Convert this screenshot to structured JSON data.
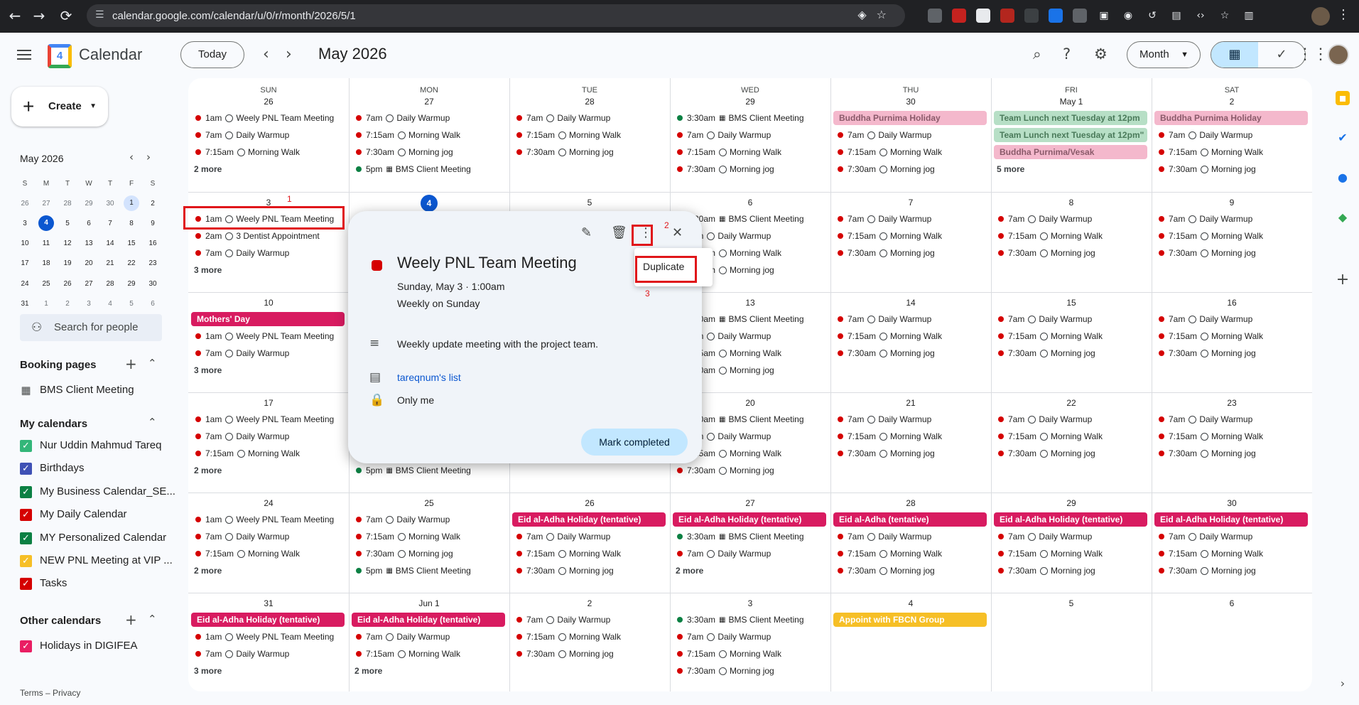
{
  "browser": {
    "url": "calendar.google.com/calendar/u/0/r/month/2026/5/1",
    "back_icon": "←",
    "forward_icon": "→",
    "reload_icon": "⟳"
  },
  "header": {
    "app_name": "Calendar",
    "logo_day": "4",
    "today_label": "Today",
    "month_title": "May 2026",
    "view_label": "Month"
  },
  "sidebar": {
    "create_label": "Create",
    "mini_title": "May 2026",
    "weekday_initials": [
      "S",
      "M",
      "T",
      "W",
      "T",
      "F",
      "S"
    ],
    "mini_weeks": [
      [
        "26",
        "27",
        "28",
        "29",
        "30",
        "1",
        "2"
      ],
      [
        "3",
        "4",
        "5",
        "6",
        "7",
        "8",
        "9"
      ],
      [
        "10",
        "11",
        "12",
        "13",
        "14",
        "15",
        "16"
      ],
      [
        "17",
        "18",
        "19",
        "20",
        "21",
        "22",
        "23"
      ],
      [
        "24",
        "25",
        "26",
        "27",
        "28",
        "29",
        "30"
      ],
      [
        "31",
        "1",
        "2",
        "3",
        "4",
        "5",
        "6"
      ]
    ],
    "search_people": "Search for people",
    "booking_title": "Booking pages",
    "booking_item": "BMS Client Meeting",
    "my_calendars_title": "My calendars",
    "my_calendars": [
      {
        "name": "Nur Uddin Mahmud Tareq",
        "color": "#33b679"
      },
      {
        "name": "Birthdays",
        "color": "#3f51b5"
      },
      {
        "name": "My Business Calendar_SE...",
        "color": "#0b8043"
      },
      {
        "name": "My Daily Calendar",
        "color": "#d50000"
      },
      {
        "name": "MY Personalized Calendar",
        "color": "#0b8043"
      },
      {
        "name": "NEW PNL Meeting at VIP ...",
        "color": "#f6bf26"
      },
      {
        "name": "Tasks",
        "color": "#d50000"
      }
    ],
    "other_calendars_title": "Other calendars",
    "other_calendars": [
      {
        "name": "Holidays in DIGIFEA",
        "color": "#e91e63"
      }
    ],
    "terms": "Terms – Privacy"
  },
  "grid": {
    "weekdays": [
      "SUN",
      "MON",
      "TUE",
      "WED",
      "THU",
      "FRI",
      "SAT"
    ],
    "day_numbers": [
      [
        "26",
        "27",
        "28",
        "29",
        "30",
        "May 1",
        "2"
      ],
      [
        "3",
        "4",
        "5",
        "6",
        "7",
        "8",
        "9"
      ],
      [
        "10",
        "11",
        "12",
        "13",
        "14",
        "15",
        "16"
      ],
      [
        "17",
        "18",
        "19",
        "20",
        "21",
        "22",
        "23"
      ],
      [
        "24",
        "25",
        "26",
        "27",
        "28",
        "29",
        "30"
      ],
      [
        "31",
        "Jun 1",
        "2",
        "3",
        "4",
        "5",
        "6"
      ]
    ],
    "weeks": [
      [
        {
          "events": [
            [
              "d",
              "1am",
              "Weely PNL Team Meeting"
            ],
            [
              "t",
              "7am",
              "Daily Warmup"
            ],
            [
              "t",
              "7:15am",
              "Morning Walk"
            ]
          ],
          "more": "2 more"
        },
        {
          "events": [
            [
              "t",
              "7am",
              "Daily Warmup"
            ],
            [
              "t",
              "7:15am",
              "Morning Walk"
            ],
            [
              "t",
              "7:30am",
              "Morning jog"
            ],
            [
              "g",
              "5pm",
              "BMS Client Meeting"
            ]
          ]
        },
        {
          "events": [
            [
              "t",
              "7am",
              "Daily Warmup"
            ],
            [
              "t",
              "7:15am",
              "Morning Walk"
            ],
            [
              "t",
              "7:30am",
              "Morning jog"
            ]
          ]
        },
        {
          "events": [
            [
              "g",
              "3:30am",
              "BMS Client Meeting"
            ],
            [
              "t",
              "7am",
              "Daily Warmup"
            ],
            [
              "t",
              "7:15am",
              "Morning Walk"
            ],
            [
              "t",
              "7:30am",
              "Morning jog"
            ]
          ]
        },
        {
          "allday": [
            [
              "Buddha Purnima Holiday",
              "#f4b8cc",
              "#8a5a6a"
            ]
          ],
          "events": [
            [
              "t",
              "7am",
              "Daily Warmup"
            ],
            [
              "t",
              "7:15am",
              "Morning Walk"
            ],
            [
              "t",
              "7:30am",
              "Morning jog"
            ]
          ]
        },
        {
          "allday": [
            [
              "Team Lunch next Tuesday at 12pm",
              "#b7dfc6",
              "#4a7a5a"
            ],
            [
              "Team Lunch next Tuesday at 12pm\"",
              "#b7dfc6",
              "#4a7a5a"
            ],
            [
              "Buddha Purnima/Vesak",
              "#f4b8cc",
              "#8a5a6a"
            ]
          ],
          "more": "5 more"
        },
        {
          "allday": [
            [
              "Buddha Purnima Holiday",
              "#f4b8cc",
              "#8a5a6a"
            ]
          ],
          "events": [
            [
              "t",
              "7am",
              "Daily Warmup"
            ],
            [
              "t",
              "7:15am",
              "Morning Walk"
            ],
            [
              "t",
              "7:30am",
              "Morning jog"
            ]
          ]
        }
      ],
      [
        {
          "events": [
            [
              "d",
              "1am",
              "Weely PNL Team Meeting"
            ],
            [
              "d",
              "2am",
              "3 Dentist Appointment"
            ],
            [
              "t",
              "7am",
              "Daily Warmup"
            ]
          ],
          "more": "3 more"
        },
        {
          "events": []
        },
        {
          "events": []
        },
        {
          "events": [
            [
              "g",
              "3:30am",
              "BMS Client Meeting"
            ],
            [
              "t",
              "7am",
              "Daily Warmup"
            ],
            [
              "t",
              "7:15am",
              "Morning Walk"
            ],
            [
              "t",
              "7:30am",
              "Morning jog"
            ]
          ]
        },
        {
          "events": [
            [
              "t",
              "7am",
              "Daily Warmup"
            ],
            [
              "t",
              "7:15am",
              "Morning Walk"
            ],
            [
              "t",
              "7:30am",
              "Morning jog"
            ]
          ]
        },
        {
          "events": [
            [
              "t",
              "7am",
              "Daily Warmup"
            ],
            [
              "t",
              "7:15am",
              "Morning Walk"
            ],
            [
              "t",
              "7:30am",
              "Morning jog"
            ]
          ]
        },
        {
          "events": [
            [
              "t",
              "7am",
              "Daily Warmup"
            ],
            [
              "t",
              "7:15am",
              "Morning Walk"
            ],
            [
              "t",
              "7:30am",
              "Morning jog"
            ]
          ]
        }
      ],
      [
        {
          "allday": [
            [
              "Mothers' Day",
              "#d81b60",
              "#ffffff"
            ]
          ],
          "events": [
            [
              "d",
              "1am",
              "Weely PNL Team Meeting"
            ],
            [
              "t",
              "7am",
              "Daily Warmup"
            ]
          ],
          "more": "3 more"
        },
        {
          "events": []
        },
        {
          "events": []
        },
        {
          "events": [
            [
              "g",
              "3:30am",
              "BMS Client Meeting"
            ],
            [
              "t",
              "7am",
              "Daily Warmup"
            ],
            [
              "t",
              "7:15am",
              "Morning Walk"
            ],
            [
              "t",
              "7:30am",
              "Morning jog"
            ]
          ]
        },
        {
          "events": [
            [
              "t",
              "7am",
              "Daily Warmup"
            ],
            [
              "t",
              "7:15am",
              "Morning Walk"
            ],
            [
              "t",
              "7:30am",
              "Morning jog"
            ]
          ]
        },
        {
          "events": [
            [
              "t",
              "7am",
              "Daily Warmup"
            ],
            [
              "t",
              "7:15am",
              "Morning Walk"
            ],
            [
              "t",
              "7:30am",
              "Morning jog"
            ]
          ]
        },
        {
          "events": [
            [
              "t",
              "7am",
              "Daily Warmup"
            ],
            [
              "t",
              "7:15am",
              "Morning Walk"
            ],
            [
              "t",
              "7:30am",
              "Morning jog"
            ]
          ]
        }
      ],
      [
        {
          "events": [
            [
              "d",
              "1am",
              "Weely PNL Team Meeting"
            ],
            [
              "t",
              "7am",
              "Daily Warmup"
            ],
            [
              "t",
              "7:15am",
              "Morning Walk"
            ]
          ],
          "more": "2 more"
        },
        {
          "events": [
            [
              "",
              "",
              ""
            ],
            [
              "",
              "",
              ""
            ],
            [
              "",
              "",
              ""
            ],
            [
              "g",
              "5pm",
              "BMS Client Meeting"
            ]
          ]
        },
        {
          "events": []
        },
        {
          "events": [
            [
              "g",
              "3:30am",
              "BMS Client Meeting"
            ],
            [
              "t",
              "7am",
              "Daily Warmup"
            ],
            [
              "t",
              "7:15am",
              "Morning Walk"
            ],
            [
              "t",
              "7:30am",
              "Morning jog"
            ]
          ]
        },
        {
          "events": [
            [
              "t",
              "7am",
              "Daily Warmup"
            ],
            [
              "t",
              "7:15am",
              "Morning Walk"
            ],
            [
              "t",
              "7:30am",
              "Morning jog"
            ]
          ]
        },
        {
          "events": [
            [
              "t",
              "7am",
              "Daily Warmup"
            ],
            [
              "t",
              "7:15am",
              "Morning Walk"
            ],
            [
              "t",
              "7:30am",
              "Morning jog"
            ]
          ]
        },
        {
          "events": [
            [
              "t",
              "7am",
              "Daily Warmup"
            ],
            [
              "t",
              "7:15am",
              "Morning Walk"
            ],
            [
              "t",
              "7:30am",
              "Morning jog"
            ]
          ]
        }
      ],
      [
        {
          "events": [
            [
              "d",
              "1am",
              "Weely PNL Team Meeting"
            ],
            [
              "t",
              "7am",
              "Daily Warmup"
            ],
            [
              "t",
              "7:15am",
              "Morning Walk"
            ]
          ],
          "more": "2 more"
        },
        {
          "events": [
            [
              "t",
              "7am",
              "Daily Warmup"
            ],
            [
              "t",
              "7:15am",
              "Morning Walk"
            ],
            [
              "t",
              "7:30am",
              "Morning jog"
            ],
            [
              "g",
              "5pm",
              "BMS Client Meeting"
            ]
          ]
        },
        {
          "allday": [
            [
              "Eid al-Adha Holiday (tentative)",
              "#d81b60",
              "#ffffff"
            ]
          ],
          "events": [
            [
              "t",
              "7am",
              "Daily Warmup"
            ],
            [
              "t",
              "7:15am",
              "Morning Walk"
            ],
            [
              "t",
              "7:30am",
              "Morning jog"
            ]
          ]
        },
        {
          "allday": [
            [
              "Eid al-Adha Holiday (tentative)",
              "#d81b60",
              "#ffffff"
            ]
          ],
          "events": [
            [
              "g",
              "3:30am",
              "BMS Client Meeting"
            ],
            [
              "t",
              "7am",
              "Daily Warmup"
            ]
          ],
          "more": "2 more"
        },
        {
          "allday": [
            [
              "Eid al-Adha (tentative)",
              "#d81b60",
              "#ffffff"
            ]
          ],
          "events": [
            [
              "t",
              "7am",
              "Daily Warmup"
            ],
            [
              "t",
              "7:15am",
              "Morning Walk"
            ],
            [
              "t",
              "7:30am",
              "Morning jog"
            ]
          ]
        },
        {
          "allday": [
            [
              "Eid al-Adha Holiday (tentative)",
              "#d81b60",
              "#ffffff"
            ]
          ],
          "events": [
            [
              "t",
              "7am",
              "Daily Warmup"
            ],
            [
              "t",
              "7:15am",
              "Morning Walk"
            ],
            [
              "t",
              "7:30am",
              "Morning jog"
            ]
          ]
        },
        {
          "allday": [
            [
              "Eid al-Adha Holiday (tentative)",
              "#d81b60",
              "#ffffff"
            ]
          ],
          "events": [
            [
              "t",
              "7am",
              "Daily Warmup"
            ],
            [
              "t",
              "7:15am",
              "Morning Walk"
            ],
            [
              "t",
              "7:30am",
              "Morning jog"
            ]
          ]
        }
      ],
      [
        {
          "allday": [
            [
              "Eid al-Adha Holiday (tentative)",
              "#d81b60",
              "#ffffff"
            ]
          ],
          "events": [
            [
              "d",
              "1am",
              "Weely PNL Team Meeting"
            ],
            [
              "t",
              "7am",
              "Daily Warmup"
            ]
          ],
          "more": "3 more"
        },
        {
          "allday": [
            [
              "Eid al-Adha Holiday (tentative)",
              "#d81b60",
              "#ffffff"
            ]
          ],
          "events": [
            [
              "t",
              "7am",
              "Daily Warmup"
            ],
            [
              "t",
              "7:15am",
              "Morning Walk"
            ]
          ],
          "more": "2 more"
        },
        {
          "events": [
            [
              "t",
              "7am",
              "Daily Warmup"
            ],
            [
              "t",
              "7:15am",
              "Morning Walk"
            ],
            [
              "t",
              "7:30am",
              "Morning jog"
            ]
          ]
        },
        {
          "events": [
            [
              "g",
              "3:30am",
              "BMS Client Meeting"
            ],
            [
              "t",
              "7am",
              "Daily Warmup"
            ],
            [
              "t",
              "7:15am",
              "Morning Walk"
            ],
            [
              "t",
              "7:30am",
              "Morning jog"
            ]
          ]
        },
        {
          "allday": [
            [
              "Appoint with FBCN Group",
              "#f6bf26",
              "#ffffff"
            ]
          ],
          "events": []
        },
        {
          "events": []
        },
        {
          "events": []
        }
      ]
    ]
  },
  "colors": {
    "red_dot": "#d50000",
    "green_dot": "#0b8043",
    "today": "#0b57d0",
    "annotation": "#e0161a"
  },
  "popover": {
    "title": "Weely PNL Team Meeting",
    "date": "Sunday, May 3  ·  1:00am",
    "recurrence": "Weekly on Sunday",
    "description": "Weekly update meeting with the project team.",
    "calendar": "tareqnum's list",
    "visibility": "Only me",
    "mark_completed": "Mark completed",
    "menu_item": "Duplicate"
  },
  "annotations": [
    "1",
    "2",
    "3"
  ]
}
